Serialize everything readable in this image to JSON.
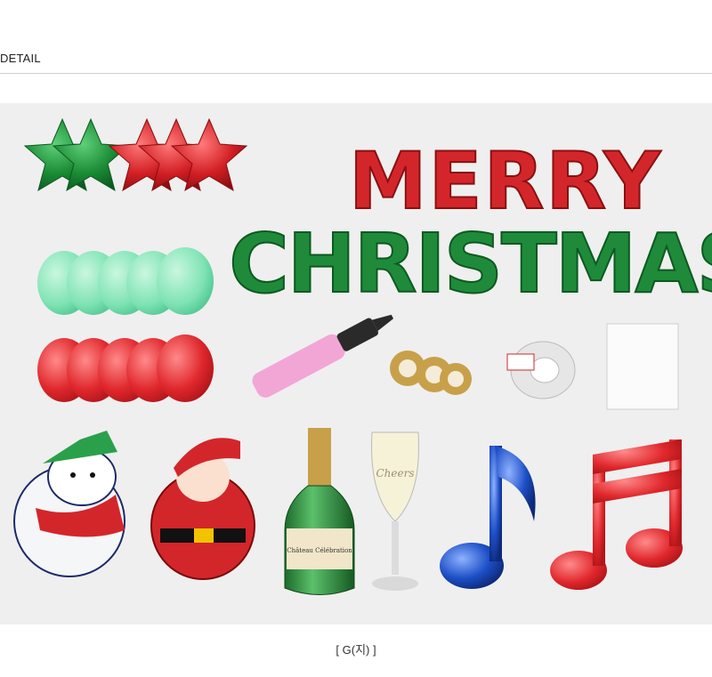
{
  "header": {
    "detail_label": "DETAIL"
  },
  "photo": {
    "banner_line1": "MERRY",
    "banner_line2": "CHRISTMAS",
    "colors": {
      "green": "#1f8a3a",
      "red": "#d3262b",
      "mint": "#7fe3b4",
      "pink": "#f2a6d6",
      "blue": "#1d4fc7",
      "gold": "#c8a04a"
    },
    "items": [
      "star-balloons",
      "mint-balloons",
      "red-balloons",
      "hand-pump",
      "ribbon-rolls",
      "glue-dot-tape",
      "glue-dot-sheet",
      "snowman-balloon",
      "santa-balloon",
      "champagne-bottle-balloon",
      "champagne-glass-balloon",
      "music-note-balloon",
      "double-music-note-balloon"
    ],
    "bottle_label": "Château Célébration",
    "glass_label": "Cheers"
  },
  "caption": "[ G(지) ]"
}
